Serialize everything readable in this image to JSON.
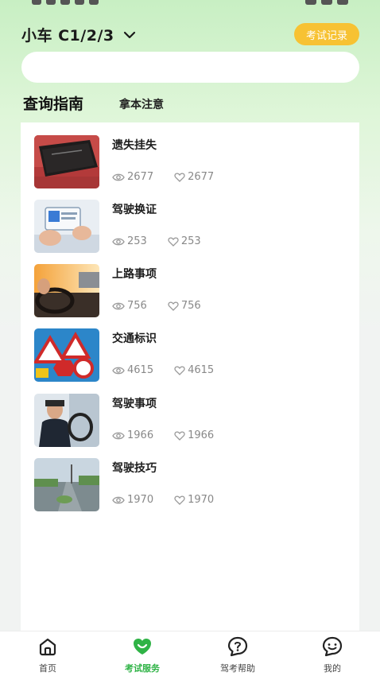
{
  "header": {
    "license_type": "小车 C1/2/3",
    "exam_record_label": "考试记录"
  },
  "search": {
    "placeholder": ""
  },
  "tabs": [
    {
      "label": "查询指南",
      "active": true
    },
    {
      "label": "拿本注意",
      "active": false
    }
  ],
  "guides": [
    {
      "title": "遗失挂失",
      "views": "2677",
      "likes": "2677",
      "image": "black-leather-license-wallet"
    },
    {
      "title": "驾驶换证",
      "views": "253",
      "likes": "253",
      "image": "hands-holding-phone"
    },
    {
      "title": "上路事项",
      "views": "756",
      "likes": "756",
      "image": "driver-on-highway"
    },
    {
      "title": "交通标识",
      "views": "4615",
      "likes": "4615",
      "image": "traffic-signs"
    },
    {
      "title": "驾驶事项",
      "views": "1966",
      "likes": "1966",
      "image": "man-in-car"
    },
    {
      "title": "驾驶技巧",
      "views": "1970",
      "likes": "1970",
      "image": "city-road"
    }
  ],
  "bottom_nav": [
    {
      "label": "首页",
      "icon": "home-icon",
      "active": false
    },
    {
      "label": "考试服务",
      "icon": "smile-heart-icon",
      "active": true
    },
    {
      "label": "驾考帮助",
      "icon": "help-bubble-icon",
      "active": false
    },
    {
      "label": "我的",
      "icon": "profile-bubble-icon",
      "active": false
    }
  ],
  "colors": {
    "accent_green": "#2fbb4a",
    "record_button": "#f7c233",
    "header_gradient_top": "#c8efc3"
  }
}
